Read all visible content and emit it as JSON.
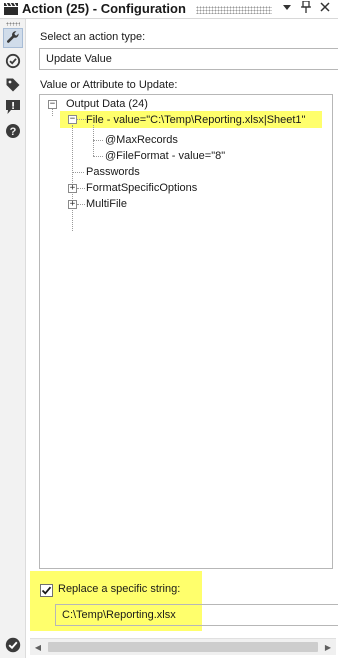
{
  "window": {
    "title": "Action (25) - Configuration",
    "icons": [
      "clapper-icon",
      "dropdown-arrow-icon",
      "pin-icon",
      "close-icon"
    ]
  },
  "rail": {
    "items": [
      {
        "name": "wrench-icon",
        "active": true
      },
      {
        "name": "connection-icon",
        "active": false
      },
      {
        "name": "tag-icon",
        "active": false
      },
      {
        "name": "message-icon",
        "active": false
      },
      {
        "name": "help-icon",
        "active": false
      }
    ],
    "status": "checkmark-icon"
  },
  "action_type": {
    "label": "Select an action type:",
    "selected": "Update Value"
  },
  "value_attr": {
    "label": "Value or Attribute to Update:"
  },
  "tree": {
    "root": {
      "label": "Output Data (24)",
      "expander": "−"
    },
    "file": {
      "label": "File - value=\"C:\\Temp\\Reporting.xlsx|Sheet1\"",
      "expander": "−",
      "highlighted": true
    },
    "maxrecords": {
      "label": "@MaxRecords"
    },
    "fileformat": {
      "label": "@FileFormat - value=\"8\""
    },
    "passwords": {
      "label": "Passwords"
    },
    "formatspecific": {
      "label": "FormatSpecificOptions",
      "expander": "+"
    },
    "multifile": {
      "label": "MultiFile",
      "expander": "+"
    }
  },
  "replace": {
    "label": "Replace a specific string:",
    "checked": true,
    "value": "C:\\Temp\\Reporting.xlsx",
    "highlighted": true
  },
  "colors": {
    "highlight": "#ffff33",
    "selection": "#d0dcea",
    "rail_icon": "#3b3b3b"
  }
}
